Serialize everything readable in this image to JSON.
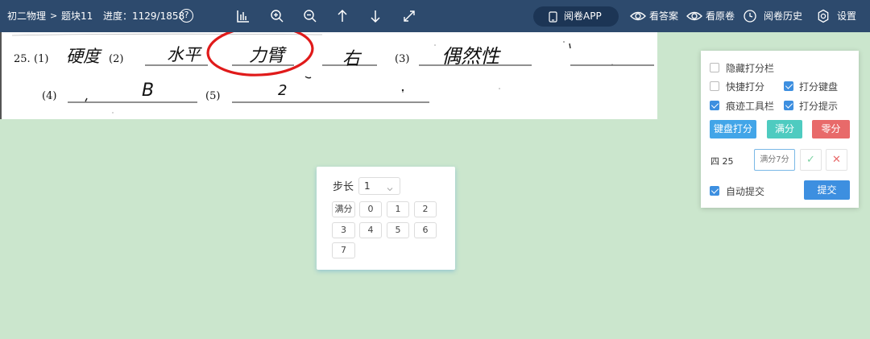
{
  "topbar": {
    "subject": "初二物理",
    "block": "题块11",
    "progress_label": "进度：",
    "progress_value": "1129/1858",
    "progress_fraction": 0.6076,
    "help_icon": "?",
    "tools": [
      "histogram-icon",
      "zoom-in-icon",
      "zoom-out-icon",
      "arrow-up-icon",
      "arrow-down-icon",
      "expand-icon"
    ],
    "app_button": "阅卷APP",
    "view_answer": "看答案",
    "view_original": "看原卷",
    "history": "阅卷历史",
    "settings": "设置"
  },
  "scan": {
    "question_no": "25.",
    "parts": [
      "(1)",
      "(2)",
      "(3)",
      "(4)",
      "(5)"
    ],
    "answers": [
      "硬度",
      "水平",
      "力臂",
      "右",
      "偶然性",
      "B",
      "2"
    ]
  },
  "step_panel": {
    "label": "步长",
    "step_value": "1",
    "full_label": "满分",
    "scores": [
      "0",
      "1",
      "2",
      "3",
      "4",
      "5",
      "6",
      "7"
    ]
  },
  "score_panel": {
    "hide_bar": "隐藏打分栏",
    "hide_bar_checked": false,
    "quick": "快捷打分",
    "quick_checked": false,
    "keyboard": "打分键盘",
    "keyboard_checked": true,
    "trace": "痕迹工具栏",
    "trace_checked": true,
    "tip": "打分提示",
    "tip_checked": true,
    "kbd_score_btn": "键盘打分",
    "full_btn": "满分",
    "zero_btn": "零分",
    "question_label": "四 25",
    "input_placeholder": "满分7分",
    "ok_icon": "✓",
    "cancel_icon": "✕",
    "auto_submit": "自动提交",
    "auto_submit_checked": true,
    "submit_btn": "提交"
  },
  "colors": {
    "topbar": "#2d4a6d",
    "background": "#cbe6cd",
    "accent_blue": "#3d8fe0",
    "teal": "#4ecbc0",
    "red": "#e86a6a",
    "mark_circle": "#e01a1a"
  }
}
